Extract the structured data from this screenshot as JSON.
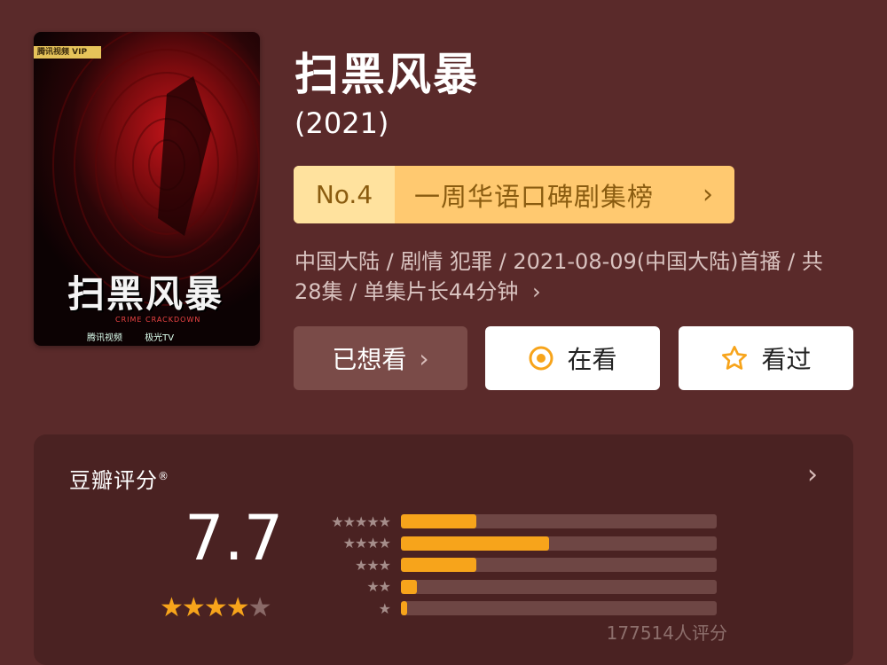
{
  "poster": {
    "badge": "腾讯视频 VIP",
    "title": "扫黑风暴",
    "subtitle": "CRIME CRACKDOWN",
    "logos": [
      "腾讯视频",
      "极光TV"
    ]
  },
  "movie": {
    "title": "扫黑风暴",
    "year": "(2021)"
  },
  "rank": {
    "no": "No.4",
    "label": "一周华语口碑剧集榜",
    "arrow": "›"
  },
  "meta": {
    "text": "中国大陆 / 剧情 犯罪 / 2021-08-09(中国大陆)首播 / 共28集 / 单集片长44分钟",
    "arrow": "›"
  },
  "actions": {
    "wish_label": "已想看",
    "wish_arrow": "›",
    "watching_label": "在看",
    "watched_label": "看过"
  },
  "rating": {
    "title": "豆瓣评分",
    "mark": "®",
    "arrow": "›",
    "score": "7.7",
    "stars": 4,
    "count_text": "177514人评分",
    "distribution": [
      {
        "stars": "★★★★★",
        "fraction": 0.24
      },
      {
        "stars": "★★★★",
        "fraction": 0.47
      },
      {
        "stars": "★★★",
        "fraction": 0.24
      },
      {
        "stars": "★★",
        "fraction": 0.05
      },
      {
        "stars": "★",
        "fraction": 0.02
      }
    ]
  },
  "colors": {
    "background": "#5a2a2a",
    "accent": "#f7a41b",
    "rank_bg": "#ffc970"
  }
}
